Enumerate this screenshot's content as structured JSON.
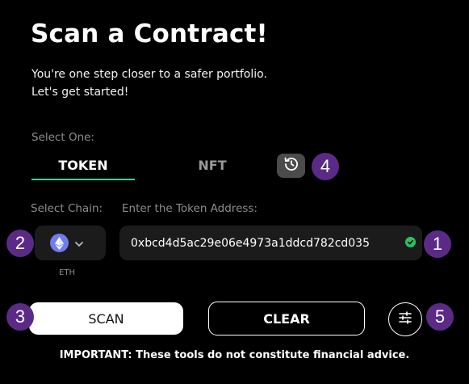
{
  "header": {
    "title": "Scan a Contract!",
    "subtitle_line1": "You're one step closer to a safer portfolio.",
    "subtitle_line2": "Let's get started!"
  },
  "select_one": {
    "label": "Select One:",
    "tabs": [
      {
        "label": "TOKEN",
        "active": true
      },
      {
        "label": "NFT",
        "active": false
      }
    ],
    "history_icon": "history-icon"
  },
  "chain": {
    "label": "Select Chain:",
    "selected": "ETH",
    "icon": "ethereum-icon"
  },
  "address": {
    "label": "Enter the Token Address:",
    "value": "0xbcd4d5ac29e06e4973a1ddcd782cd035",
    "status_icon": "valid-check-icon"
  },
  "actions": {
    "scan_label": "SCAN",
    "clear_label": "CLEAR",
    "settings_icon": "sliders-icon"
  },
  "badges": [
    "1",
    "2",
    "3",
    "4",
    "5"
  ],
  "disclaimer": "IMPORTANT: These tools do not constitute financial advice.",
  "colors": {
    "accent": "#34d399",
    "badge": "#5b2a86",
    "valid": "#22c55e",
    "eth": "#6f7ee8"
  }
}
